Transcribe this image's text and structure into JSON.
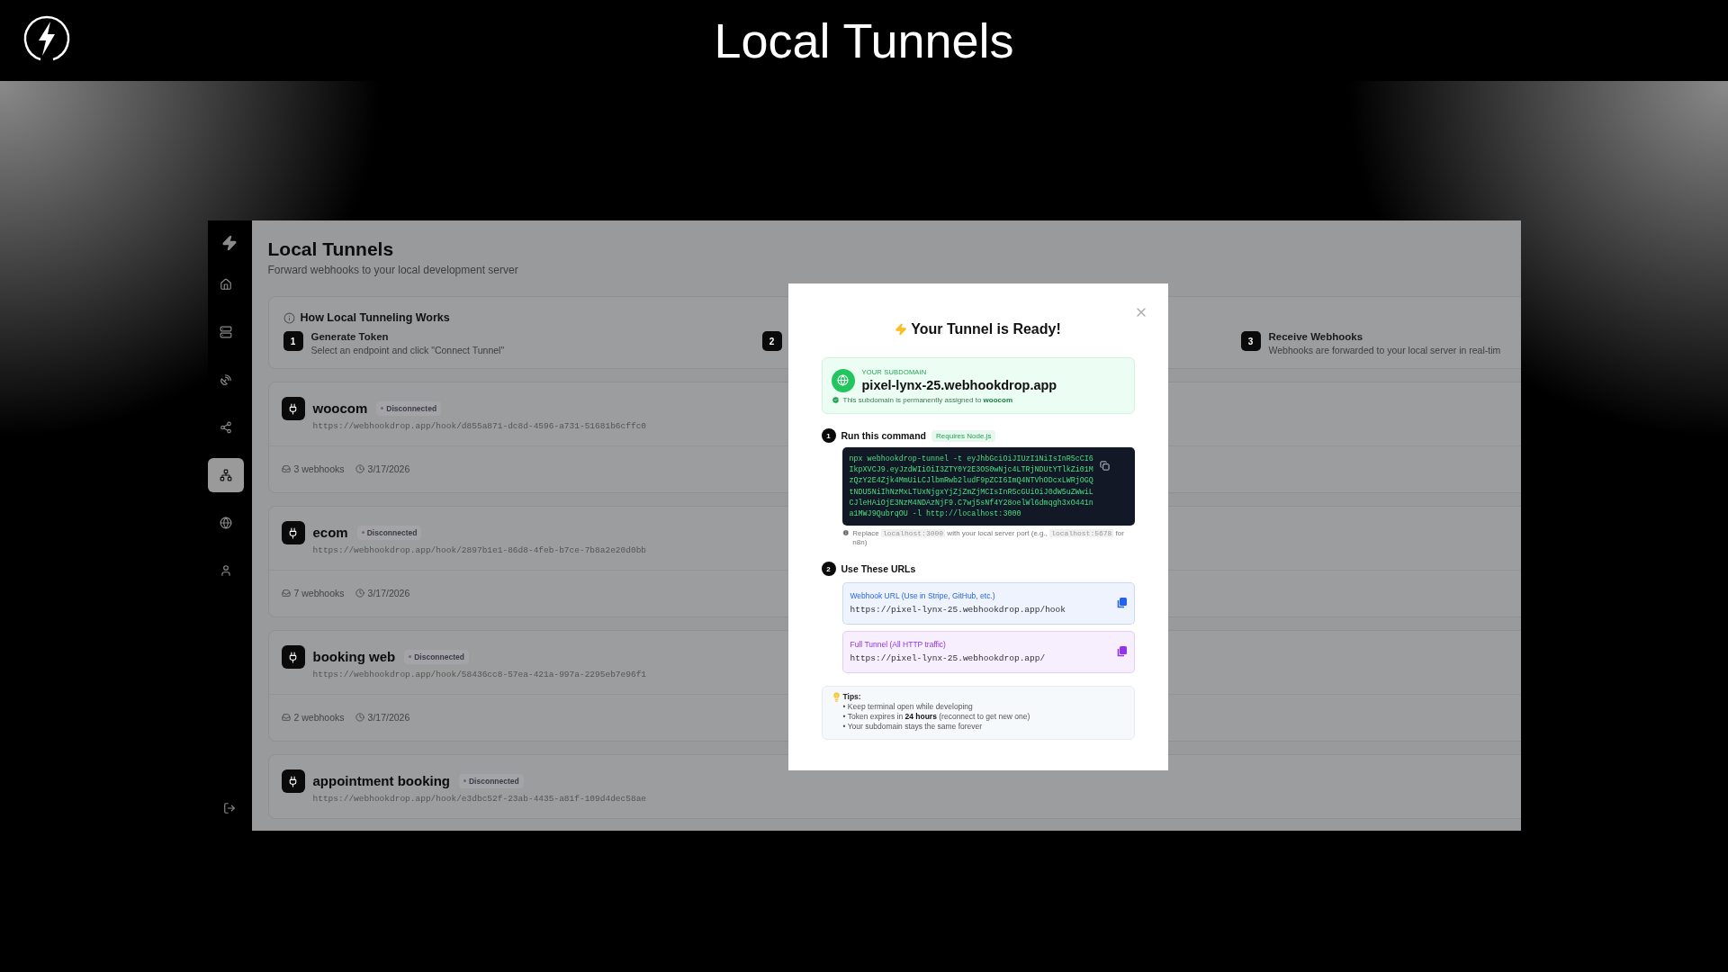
{
  "header": {
    "title": "Local Tunnels"
  },
  "sidebar": {
    "items": [
      {
        "selected": false
      },
      {
        "selected": false
      },
      {
        "selected": false
      },
      {
        "selected": false
      },
      {
        "selected": true
      },
      {
        "selected": false
      },
      {
        "selected": false
      }
    ]
  },
  "page": {
    "title": "Local Tunnels",
    "subtitle": "Forward webhooks to your local development server"
  },
  "how_it_works": {
    "title": "How Local Tunneling Works",
    "steps": [
      {
        "number": "1",
        "title": "Generate Token",
        "description": "Select an endpoint and click \"Connect Tunnel\""
      },
      {
        "number": "2"
      },
      {
        "number": "3",
        "title": "Receive Webhooks",
        "description": "Webhooks are forwarded to your local server in real-tim"
      }
    ]
  },
  "endpoints": [
    {
      "name": "woocom",
      "status": "Disconnected",
      "url": "https://webhookdrop.app/hook/d855a871-dc8d-4596-a731-51681b6cffc0",
      "webhooks": "3 webhooks",
      "date": "3/17/2026"
    },
    {
      "name": "ecom",
      "status": "Disconnected",
      "url": "https://webhookdrop.app/hook/2897b1e1-86d8-4feb-b7ce-7b8a2e20d0bb",
      "webhooks": "7 webhooks",
      "date": "3/17/2026"
    },
    {
      "name": "booking web",
      "status": "Disconnected",
      "url": "https://webhookdrop.app/hook/58436cc8-57ea-421a-997a-2295eb7e96f1",
      "webhooks": "2 webhooks",
      "date": "3/17/2026"
    },
    {
      "name": "appointment booking",
      "status": "Disconnected",
      "url": "https://webhookdrop.app/hook/e3dbc52f-23ab-4435-a81f-109d4dec58ae"
    }
  ],
  "modal": {
    "title": "Your Tunnel is Ready!",
    "subdomain_label": "YOUR SUBDOMAIN",
    "subdomain": "pixel-lynx-25.webhookdrop.app",
    "assigned_note": "This subdomain is permanently assigned to **woocom**",
    "command_step": {
      "number": "1",
      "title": "Run this command",
      "badge": "Requires Node.js"
    },
    "command": "npx webhookdrop-tunnel -t eyJhbGciOiJIUzI1NiIsInR5cCI6IkpXVCJ9.eyJzdWIiOiI3ZTY0Y2E3OS0wNjc4LTRjNDUtYTlkZi01MzQzY2E4Zjk4MmUiLCJlbmRwb2ludF9pZCI6ImQ4NTVhODcxLWRjOGQtNDU5NiIhNzMxLTUxNjgxYjZjZmZjMCIsInR5cGUiOiJ0dW5uZWwiLCJleHAiOjE3NzM4NDAzNjF9.C7wj5sNf4Y28oelWl6dmqgh3xO441na1MWJ9QubrqOU -l http://localhost:3000",
    "note": [
      {
        "kind": "text",
        "text": "Replace "
      },
      {
        "kind": "code",
        "text": "localhost:3000"
      },
      {
        "kind": "text",
        "text": " with your local server port (e.g., "
      },
      {
        "kind": "code",
        "text": "localhost:5678"
      },
      {
        "kind": "text",
        "text": " for n8n)"
      }
    ],
    "urls_step": {
      "number": "2",
      "title": "Use These URLs"
    },
    "urls": [
      {
        "label": "Webhook URL (Use in Stripe, GitHub, etc.)",
        "url": "https://pixel-lynx-25.webhookdrop.app/hook",
        "color": "#2563eb"
      },
      {
        "label": "Full Tunnel (All HTTP traffic)",
        "url": "https://pixel-lynx-25.webhookdrop.app/",
        "color": "#9333ea"
      }
    ],
    "tips": {
      "title": "Tips:",
      "items": [
        "• Keep terminal open while developing",
        "• Token expires in **24 hours** (reconnect to get new one)",
        "• Your subdomain stays the same forever"
      ]
    }
  }
}
